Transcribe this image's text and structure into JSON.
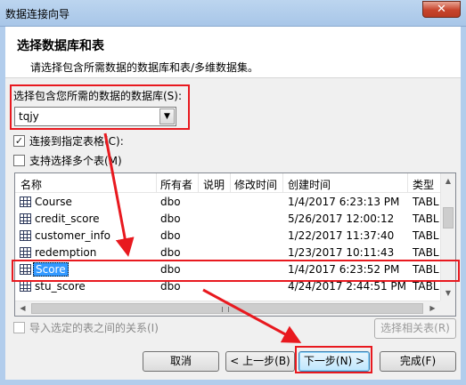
{
  "window": {
    "title": "数据连接向导",
    "close_label": "✕"
  },
  "header": {
    "title": "选择数据库和表",
    "subtitle": "请选择包含所需数据的数据库和表/多维数据集。"
  },
  "database": {
    "label": "选择包含您所需的数据的数据库(S):",
    "selected": "tqjy"
  },
  "options": {
    "connect_specific_table": {
      "label": "连接到指定表格(C):",
      "checked": true
    },
    "multi_select": {
      "label": "支持选择多个表(M)",
      "checked": false
    }
  },
  "table_list": {
    "columns": [
      "名称",
      "所有者",
      "说明",
      "修改时间",
      "创建时间",
      "类型"
    ],
    "rows": [
      {
        "name": "Course",
        "owner": "dbo",
        "created": "1/4/2017 6:23:13 PM",
        "type": "TABL",
        "selected": false
      },
      {
        "name": "credit_score",
        "owner": "dbo",
        "created": "5/26/2017 12:00:12",
        "type": "TABL",
        "selected": false
      },
      {
        "name": "customer_info",
        "owner": "dbo",
        "created": "1/22/2017 11:37:40",
        "type": "TABL",
        "selected": false
      },
      {
        "name": "redemption",
        "owner": "dbo",
        "created": "1/23/2017 10:11:43",
        "type": "TABL",
        "selected": false
      },
      {
        "name": "Score",
        "owner": "dbo",
        "created": "1/4/2017 6:23:52 PM",
        "type": "TABL",
        "selected": true
      },
      {
        "name": "stu_score",
        "owner": "dbo",
        "created": "4/24/2017 2:44:51 PM",
        "type": "TABL",
        "selected": false
      }
    ]
  },
  "relations": {
    "import_label": "导入选定的表之间的关系(I)",
    "select_related_label": "选择相关表(R)"
  },
  "buttons": {
    "cancel": "取消",
    "back": "< 上一步(B)",
    "next": "下一步(N) >",
    "finish": "完成(F)"
  },
  "colors": {
    "highlight": "#e8191f",
    "selection": "#3399ff"
  }
}
